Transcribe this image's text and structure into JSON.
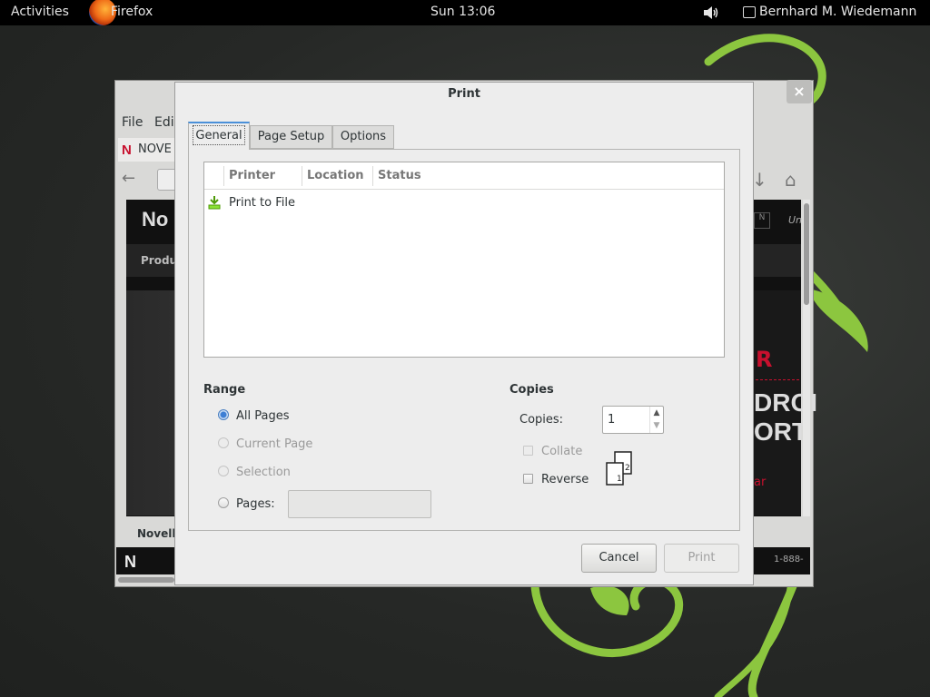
{
  "topbar": {
    "activities": "Activities",
    "app_name": "Firefox",
    "clock": "Sun 13:06",
    "user": "Bernhard M. Wiedemann"
  },
  "firefox": {
    "menu_file": "File",
    "menu_edit": "Edi",
    "tab_logo": "N",
    "tab_title": "NOVE",
    "page_brand": "No",
    "page_nav": "Produ",
    "page_hero_r": "R",
    "page_hero_line1": "DROI",
    "page_hero_line2": "ORT",
    "page_hero_ar": "ar",
    "page_hero_un": "Un",
    "page_hero_n": "N",
    "page_novell": "Novell",
    "footer_logo": "N",
    "footer_phone": "1-888-"
  },
  "dialog": {
    "title": "Print",
    "tabs": [
      {
        "label": "General",
        "selected": true
      },
      {
        "label": "Page Setup",
        "selected": false
      },
      {
        "label": "Options",
        "selected": false
      }
    ],
    "printer_list": {
      "columns": [
        "Printer",
        "Location",
        "Status"
      ],
      "rows": [
        {
          "icon": "print-to-file-icon",
          "name": "Print to File",
          "location": "",
          "status": ""
        }
      ]
    },
    "range": {
      "title": "Range",
      "options": [
        {
          "label": "All Pages",
          "checked": true,
          "enabled": true
        },
        {
          "label": "Current Page",
          "checked": false,
          "enabled": false
        },
        {
          "label": "Selection",
          "checked": false,
          "enabled": false
        },
        {
          "label": "Pages:",
          "checked": false,
          "enabled": true
        }
      ],
      "pages_value": ""
    },
    "copies": {
      "title": "Copies",
      "label": "Copies:",
      "value": "1",
      "collate_label": "Collate",
      "collate_checked": false,
      "collate_enabled": false,
      "reverse_label": "Reverse",
      "reverse_checked": false,
      "preview_page_a": "1",
      "preview_page_b": "2"
    },
    "buttons": {
      "cancel": "Cancel",
      "print": "Print"
    }
  },
  "colors": {
    "accent": "#4a90d9",
    "desktop_swirl": "#8cc63f"
  }
}
